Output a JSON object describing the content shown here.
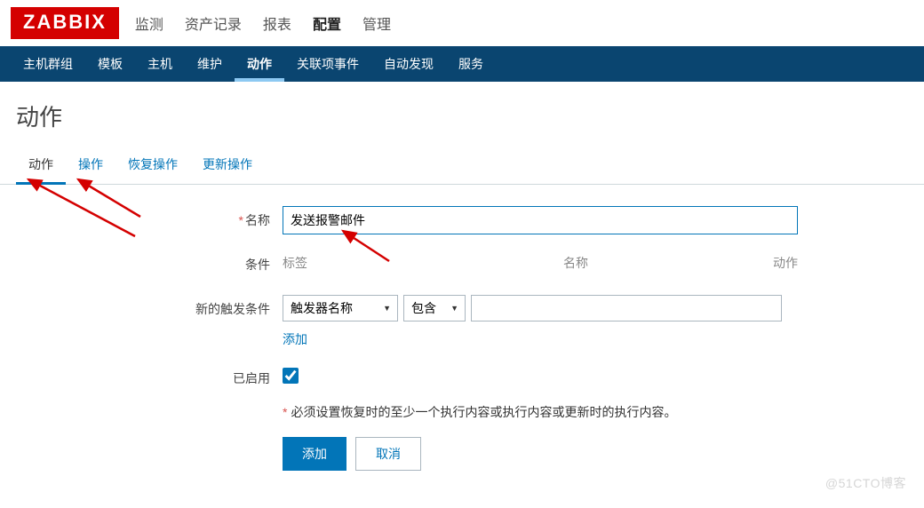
{
  "logo": "ZABBIX",
  "top_nav": {
    "items": [
      "监测",
      "资产记录",
      "报表",
      "配置",
      "管理"
    ],
    "active_index": 3
  },
  "sub_nav": {
    "items": [
      "主机群组",
      "模板",
      "主机",
      "维护",
      "动作",
      "关联项事件",
      "自动发现",
      "服务"
    ],
    "active_index": 4
  },
  "page_title": "动作",
  "tabs": {
    "items": [
      "动作",
      "操作",
      "恢复操作",
      "更新操作"
    ],
    "active_index": 0
  },
  "form": {
    "name_label": "名称",
    "name_value": "发送报警邮件",
    "conditions_label": "条件",
    "cond_headers": [
      "标签",
      "名称",
      "动作"
    ],
    "new_trigger_label": "新的触发条件",
    "trigger_type": "触发器名称",
    "trigger_op": "包含",
    "trigger_value": "",
    "add_link": "添加",
    "enabled_label": "已启用",
    "enabled": true,
    "warn": "必须设置恢复时的至少一个执行内容或执行内容或更新时的执行内容。",
    "submit": "添加",
    "cancel": "取消"
  },
  "watermark": "@51CTO博客"
}
